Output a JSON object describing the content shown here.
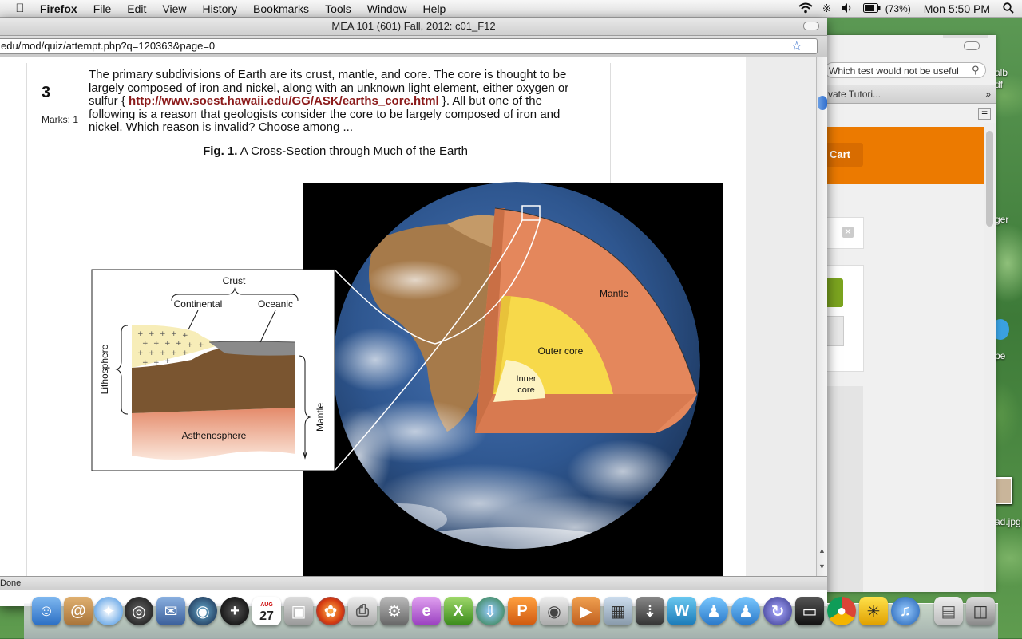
{
  "menubar": {
    "app": "Firefox",
    "items": [
      "File",
      "Edit",
      "View",
      "History",
      "Bookmarks",
      "Tools",
      "Window",
      "Help"
    ],
    "battery": "(73%)",
    "clock": "Mon 5:50 PM"
  },
  "window": {
    "title": "MEA 101 (601) Fall, 2012: c01_F12",
    "url": "edu/mod/quiz/attempt.php?q=120363&page=0",
    "status": "Done"
  },
  "question": {
    "number": "3",
    "marks": "Marks: 1",
    "text_before_link": "The primary subdivisions of Earth are its crust, mantle, and core. The core is thought to be largely composed of iron and nickel, along with an unknown light element, either oxygen or sulfur { ",
    "link": "http://www.soest.hawaii.edu/GG/ASK/earths_core.html",
    "text_after_link": " }. All but one of the following is a reason that geologists consider the core to be largely composed of iron and nickel. Which reason is invalid? Choose among ..."
  },
  "figure": {
    "caption_label": "Fig. 1.",
    "caption_text": " A Cross-Section through Much of the Earth",
    "labels": {
      "crust": "Crust",
      "continental": "Continental",
      "oceanic": "Oceanic",
      "lithosphere": "Lithosphere",
      "mantle_inset": "Mantle",
      "asthenosphere": "Asthenosphere",
      "mantle": "Mantle",
      "outer_core": "Outer core",
      "inner_core_1": "Inner",
      "inner_core_2": "core"
    }
  },
  "background_window": {
    "search_text": "Which test would not be useful",
    "tab_text": "vate Tutori...",
    "cart_label": "Cart"
  },
  "desktop_labels": [
    "alb",
    "df",
    "ger",
    "pe",
    "ad.jpg"
  ],
  "dock": {
    "calendar_day": "27",
    "calendar_month": "AUG"
  }
}
